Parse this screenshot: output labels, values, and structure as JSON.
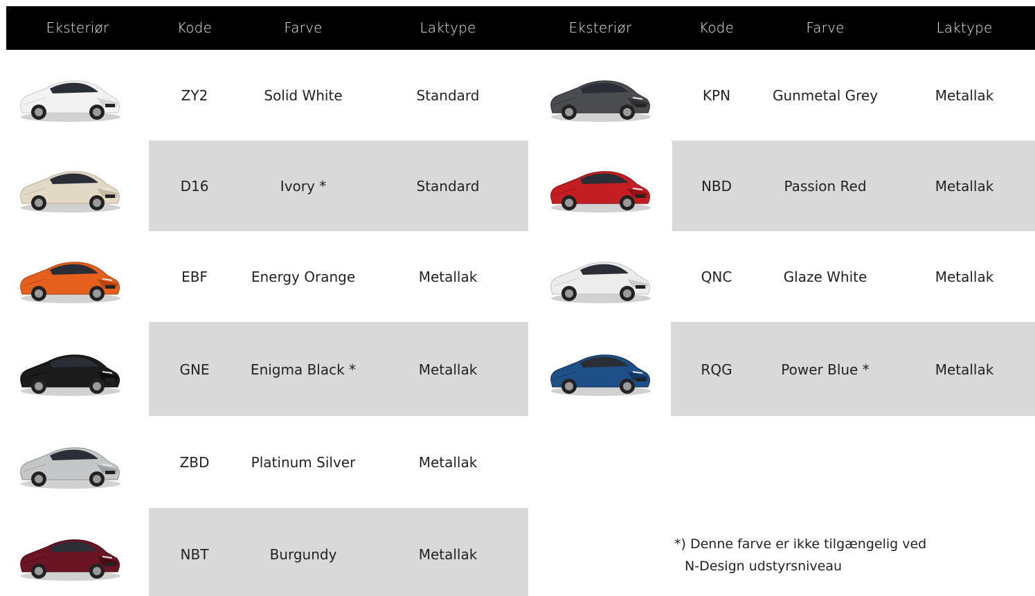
{
  "header": {
    "left": [
      "Eksteriør",
      "Kode",
      "Farve",
      "Laktype"
    ],
    "right": [
      "Eksteriør",
      "Kode",
      "Farve",
      "Laktype"
    ]
  },
  "left_rows": [
    {
      "code": "ZY2",
      "color": "Solid White",
      "paint": "Standard",
      "body": "#f2f2f2",
      "dark": "#c9c9c9"
    },
    {
      "code": "D16",
      "color": "Ivory *",
      "paint": "Standard",
      "body": "#e2d8c6",
      "dark": "#b9ad96"
    },
    {
      "code": "EBF",
      "color": "Energy Orange",
      "paint": "Metallak",
      "body": "#e5601c",
      "dark": "#a63c0a"
    },
    {
      "code": "GNE",
      "color": "Enigma Black *",
      "paint": "Metallak",
      "body": "#1b1b1b",
      "dark": "#050505"
    },
    {
      "code": "ZBD",
      "color": "Platinum Silver",
      "paint": "Metallak",
      "body": "#c4c6c8",
      "dark": "#8e9194"
    },
    {
      "code": "NBT",
      "color": "Burgundy",
      "paint": "Metallak",
      "body": "#6b1424",
      "dark": "#3e0812"
    }
  ],
  "right_rows": [
    {
      "code": "KPN",
      "color": "Gunmetal Grey",
      "paint": "Metallak",
      "body": "#4a4c50",
      "dark": "#26282b"
    },
    {
      "code": "NBD",
      "color": "Passion Red",
      "paint": "Metallak",
      "body": "#c41e23",
      "dark": "#800c10"
    },
    {
      "code": "QNC",
      "color": "Glaze White",
      "paint": "Metallak",
      "body": "#ececec",
      "dark": "#bdbdbd"
    },
    {
      "code": "RQG",
      "color": "Power Blue *",
      "paint": "Metallak",
      "body": "#1e4f86",
      "dark": "#0f2c52"
    }
  ],
  "note": {
    "line1": "*) Denne farve er ikke tilgængelig ved",
    "line2": "N-Design udstyrsniveau"
  }
}
